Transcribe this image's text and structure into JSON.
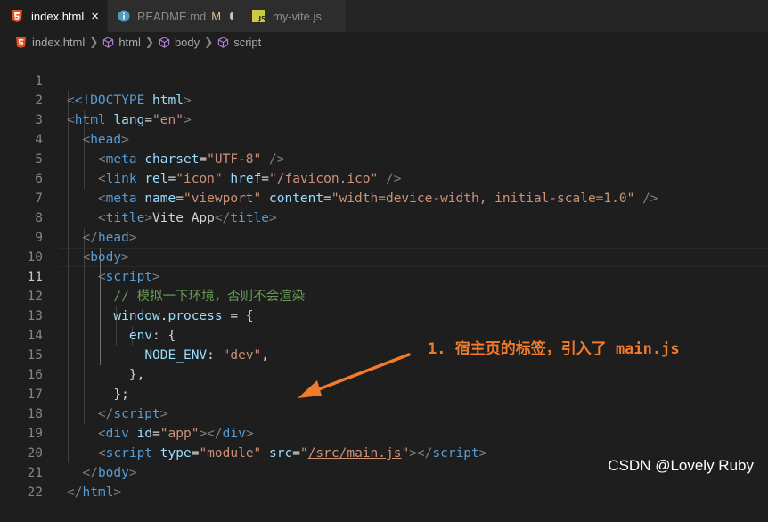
{
  "tabs": [
    {
      "label": "index.html",
      "active": true,
      "icon": "html5-icon",
      "close": "×"
    },
    {
      "label": "README.md",
      "active": false,
      "icon": "info-icon",
      "status": "M"
    },
    {
      "label": "my-vite.js",
      "active": false,
      "icon": "js-icon"
    }
  ],
  "breadcrumb": [
    "index.html",
    "html",
    "body",
    "script"
  ],
  "current_line": 11,
  "line_numbers": [
    "1",
    "2",
    "3",
    "4",
    "5",
    "6",
    "7",
    "8",
    "9",
    "10",
    "11",
    "12",
    "13",
    "14",
    "15",
    "16",
    "17",
    "18",
    "19",
    "20",
    "21",
    "22"
  ],
  "code": {
    "l1_doctype": "<!DOCTYPE",
    "l1_html": "html",
    "l2_tag": "html",
    "l2_attr": "lang",
    "l2_val": "\"en\"",
    "l3_tag": "head",
    "l4_tag": "meta",
    "l4_attr": "charset",
    "l4_val": "\"UTF-8\"",
    "l5_tag": "link",
    "l5_attr1": "rel",
    "l5_val1": "\"icon\"",
    "l5_attr2": "href",
    "l5_val2_q": "\"",
    "l5_val2_link": "/favicon.ico",
    "l6_tag": "meta",
    "l6_attr1": "name",
    "l6_val1": "\"viewport\"",
    "l6_attr2": "content",
    "l6_val2": "\"width=device-width, initial-scale=1.0\"",
    "l7_tag": "title",
    "l7_text": "Vite App",
    "l8_tag": "head",
    "l9_tag": "body",
    "l10_tag": "script",
    "l11_comment": "// 模拟一下环境，否则不会渲染",
    "l12_obj": "window",
    "l12_prop": "process",
    "l12_rest": " = {",
    "l13_key": "env",
    "l13_rest": ": {",
    "l14_key": "NODE_ENV",
    "l14_val": "\"dev\"",
    "l15_text": "},",
    "l16_text": "};",
    "l17_tag": "script",
    "l18_tag": "div",
    "l18_attr": "id",
    "l18_val": "\"app\"",
    "l19_tag": "script",
    "l19_attr1": "type",
    "l19_val1": "\"module\"",
    "l19_attr2": "src",
    "l19_val2_link": "/src/main.js",
    "l20_tag": "body",
    "l21_tag": "html"
  },
  "annotation": "1. 宿主页的标签，引入了 main.js",
  "watermark": "CSDN @Lovely Ruby",
  "colors": {
    "accent": "#f07b2b",
    "tag": "#569cd6",
    "attr": "#9cdcfe",
    "string": "#ce9178",
    "comment": "#6a9955",
    "background": "#1e1e1e"
  }
}
